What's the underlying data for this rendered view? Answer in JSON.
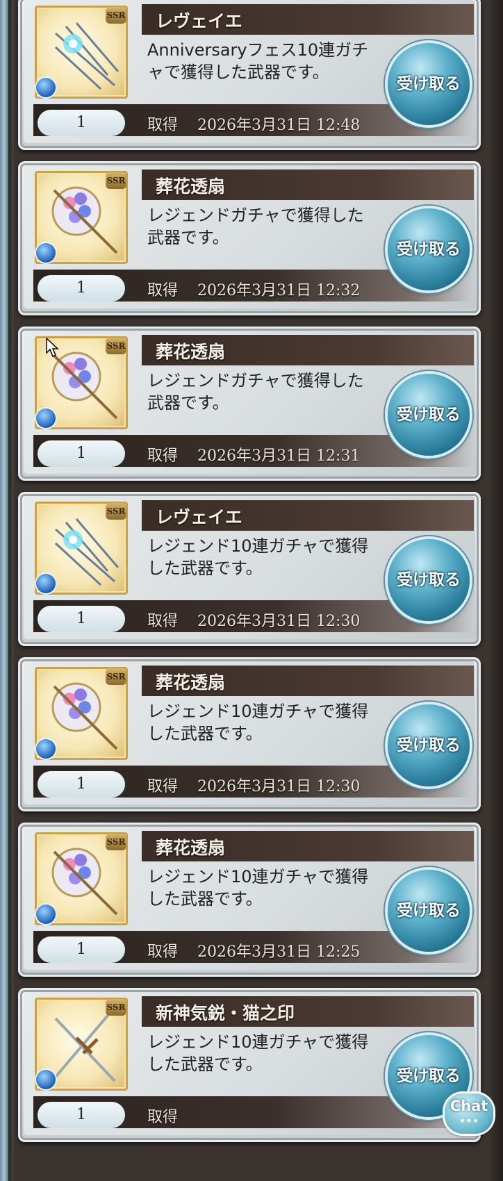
{
  "items": [
    {
      "name": "レヴェイエ",
      "description": "Anniversaryフェス10連ガチャで獲得した武器です。",
      "quantity": "1",
      "acquired_label": "取得",
      "acquired_at": "2026年3月31日 12:48",
      "receive_label": "受け取る",
      "rarity": "SSR",
      "thumb": "reveille-weapon"
    },
    {
      "name": "葬花透扇",
      "description": "レジェンドガチャで獲得した武器です。",
      "quantity": "1",
      "acquired_label": "取得",
      "acquired_at": "2026年3月31日 12:32",
      "receive_label": "受け取る",
      "rarity": "SSR",
      "thumb": "flower-fan-weapon"
    },
    {
      "name": "葬花透扇",
      "description": "レジェンドガチャで獲得した武器です。",
      "quantity": "1",
      "acquired_label": "取得",
      "acquired_at": "2026年3月31日 12:31",
      "receive_label": "受け取る",
      "rarity": "SSR",
      "thumb": "flower-fan-weapon"
    },
    {
      "name": "レヴェイエ",
      "description": "レジェンド10連ガチャで獲得した武器です。",
      "quantity": "1",
      "acquired_label": "取得",
      "acquired_at": "2026年3月31日 12:30",
      "receive_label": "受け取る",
      "rarity": "SSR",
      "thumb": "reveille-weapon"
    },
    {
      "name": "葬花透扇",
      "description": "レジェンド10連ガチャで獲得した武器です。",
      "quantity": "1",
      "acquired_label": "取得",
      "acquired_at": "2026年3月31日 12:30",
      "receive_label": "受け取る",
      "rarity": "SSR",
      "thumb": "flower-fan-weapon"
    },
    {
      "name": "葬花透扇",
      "description": "レジェンド10連ガチャで獲得した武器です。",
      "quantity": "1",
      "acquired_label": "取得",
      "acquired_at": "2026年3月31日 12:25",
      "receive_label": "受け取る",
      "rarity": "SSR",
      "thumb": "flower-fan-weapon"
    },
    {
      "name": "新神気鋭・猫之印",
      "description": "レジェンド10連ガチャで獲得した武器です。",
      "quantity": "1",
      "acquired_label": "取得",
      "acquired_at": "",
      "receive_label": "受け取る",
      "rarity": "SSR",
      "thumb": "crossed-swords-weapon"
    }
  ],
  "chat_button": {
    "label": "Chat"
  },
  "colors": {
    "accent_blue": "#2a7d9b",
    "title_bar": "#3a2c27",
    "card_bg": "#e3e7e8"
  }
}
